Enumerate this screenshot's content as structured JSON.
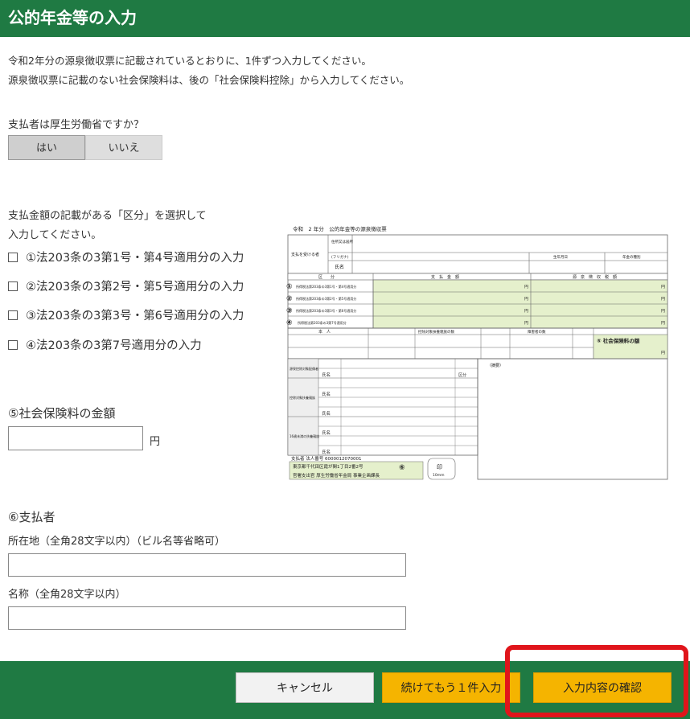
{
  "header": {
    "title": "公的年金等の入力"
  },
  "intro": {
    "line1": "令和2年分の源泉徴収票に記載されているとおりに、1件ずつ入力してください。",
    "line2": "源泉徴収票に記載のない社会保険料は、後の「社会保険料控除」から入力してください。"
  },
  "payer_question": {
    "label": "支払者は厚生労働省ですか？",
    "yes": "はい",
    "no": "いいえ",
    "selected": "はい"
  },
  "category": {
    "prompt1": "支払金額の記載がある「区分」を選択して",
    "prompt2": "入力してください。",
    "options": [
      "①法203条の3第1号・第4号適用分の入力",
      "②法203条の3第2号・第5号適用分の入力",
      "③法203条の3第3号・第6号適用分の入力",
      "④法203条の3第7号適用分の入力"
    ]
  },
  "social_insurance": {
    "heading": "⑤社会保険料の金額",
    "unit": "円",
    "value": ""
  },
  "payer": {
    "heading": "⑥支払者",
    "address_label": "所在地（全角28文字以内）（ビル名等省略可）",
    "address_value": "",
    "name_label": "名称（全角28文字以内）",
    "name_value": ""
  },
  "form_image": {
    "title": "令和　2 年分　公的年金等の源泉徴収票",
    "recipient": "支払を受ける者",
    "address": "住所又は居所",
    "furigana": "(フリガナ)",
    "name": "氏名",
    "birth_date": "生年月日",
    "pension_type": "年金の種別",
    "kubun": "区　　分",
    "payment_amount": "支　払　金　額",
    "withholding": "源　泉　徴　収　税　額",
    "rows": [
      "所得税法第203条の3第1号・第4号適用分",
      "所得税法第203条の3第2号・第5号適用分",
      "所得税法第203条の3第3号・第6号適用分",
      "所得税法第203条の3第7号適用分"
    ],
    "row_markers": [
      "①",
      "②",
      "③",
      "④"
    ],
    "yen": "円",
    "honnin": "本　人",
    "deduction_family": "控除対象扶養親族の数",
    "disabled_count": "障害者の数",
    "social_insurance_label": "⑤ 社会保険料の額",
    "summary": "（摘要）",
    "spouse": "源泉控除対象配偶者",
    "dependents": "控除対象扶養親族",
    "under16": "16歳未満の扶養親族",
    "ku": "区分",
    "payer_number": "支払者  法人番号  6000012070001",
    "payer_address": "東京都千代田区霞が関1丁目2番2号",
    "payer_name": "官署支出官  厚生労働省年金局  事業企画課長",
    "marker6": "⑥",
    "seal": "印",
    "seal_size": "10mm"
  },
  "footer": {
    "cancel": "キャンセル",
    "continue": "続けてもう１件入力",
    "confirm": "入力内容の確認"
  },
  "colors": {
    "header_green": "#1f7a43",
    "button_yellow": "#f5b400",
    "highlight_red": "#e0151b",
    "form_green": "#e5f0cc"
  }
}
